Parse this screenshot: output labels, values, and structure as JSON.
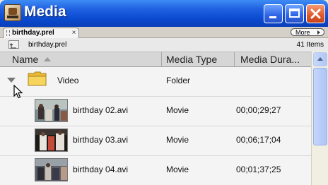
{
  "window": {
    "title": "Media"
  },
  "tab": {
    "label": "birthday.prel",
    "close_glyph": "×"
  },
  "more_button": {
    "label": "More"
  },
  "path_bar": {
    "path": "birthday.prel",
    "count": "41 Items"
  },
  "columns": {
    "name": "Name",
    "media_type": "Media Type",
    "media_duration": "Media Dura..."
  },
  "rows": [
    {
      "name": "Video",
      "type": "Folder",
      "duration": ""
    },
    {
      "name": "birthday 02.avi",
      "type": "Movie",
      "duration": "00;00;29;27"
    },
    {
      "name": "birthday 03.avi",
      "type": "Movie",
      "duration": "00;06;17;04"
    },
    {
      "name": "birthday 04.avi",
      "type": "Movie",
      "duration": "00;01;37;25"
    }
  ]
}
